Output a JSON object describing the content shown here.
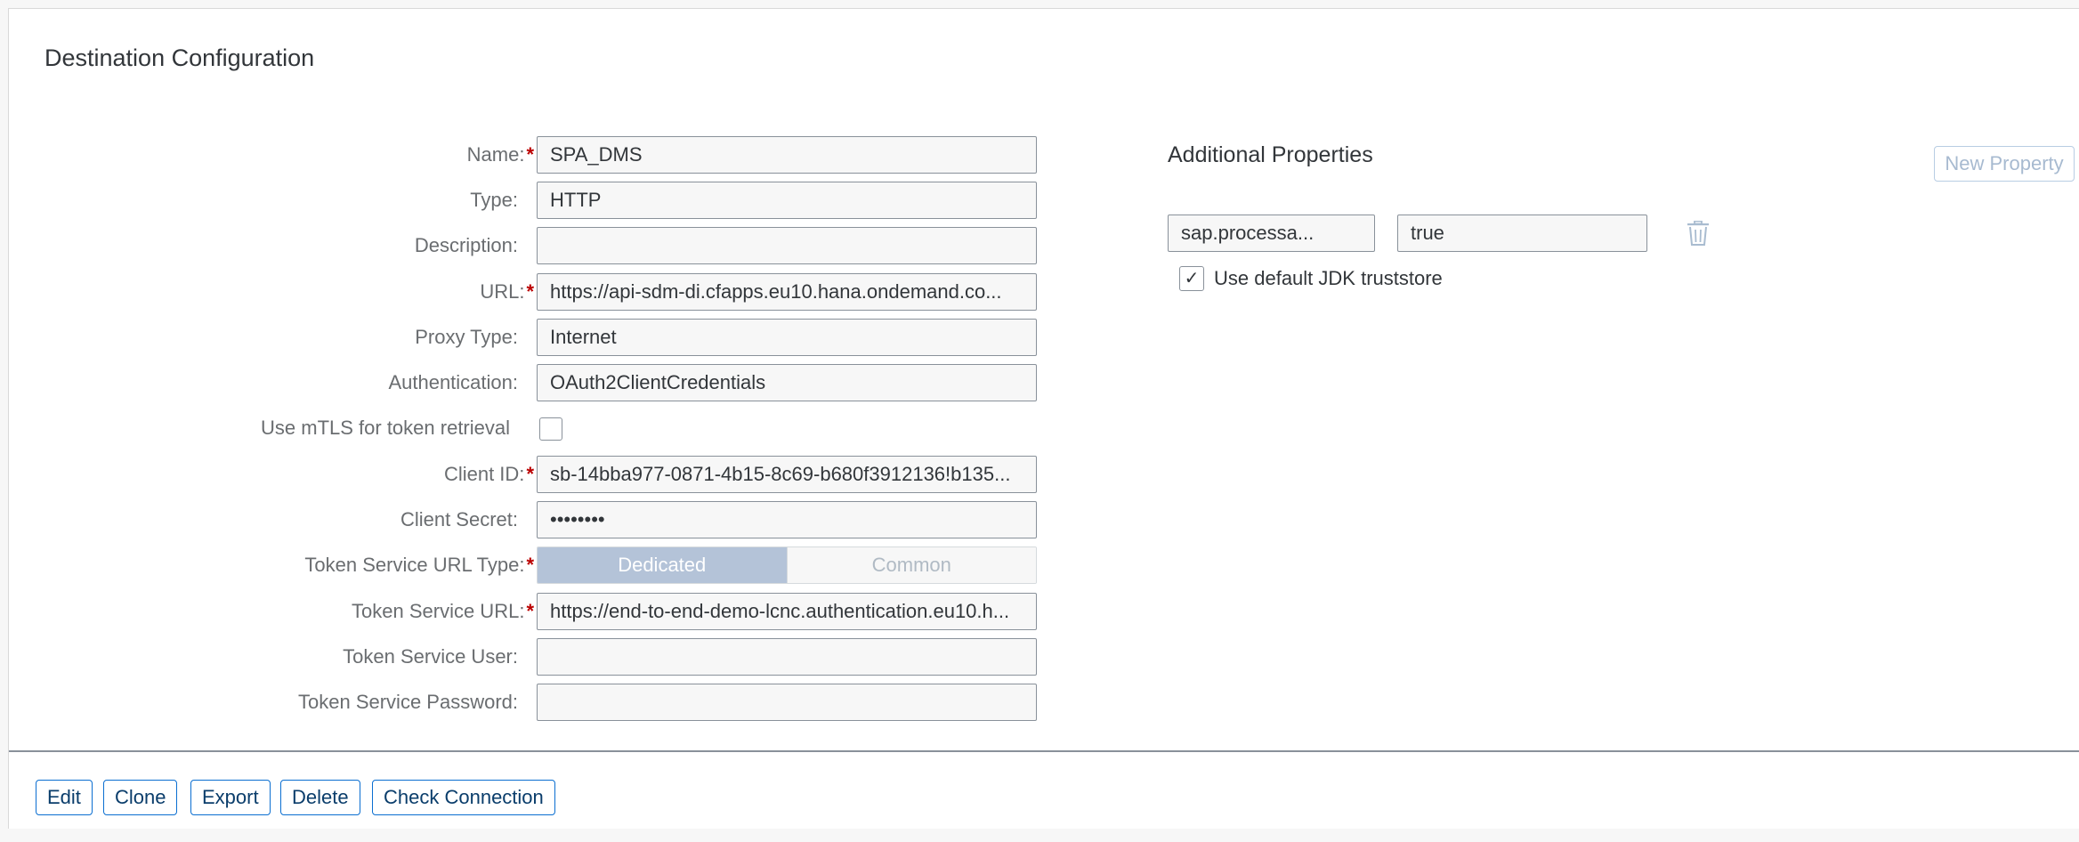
{
  "header": {
    "title": "Destination Configuration"
  },
  "form": {
    "name": {
      "label": "Name:",
      "value": "SPA_DMS"
    },
    "type": {
      "label": "Type:",
      "value": "HTTP"
    },
    "description": {
      "label": "Description:",
      "value": ""
    },
    "url": {
      "label": "URL:",
      "value": "https://api-sdm-di.cfapps.eu10.hana.ondemand.co..."
    },
    "proxy_type": {
      "label": "Proxy Type:",
      "value": "Internet"
    },
    "authentication": {
      "label": "Authentication:",
      "value": "OAuth2ClientCredentials"
    },
    "mtls": {
      "label": "Use mTLS for token retrieval",
      "checked": false
    },
    "client_id": {
      "label": "Client ID:",
      "value": "sb-14bba977-0871-4b15-8c69-b680f3912136!b135..."
    },
    "client_secret": {
      "label": "Client Secret:",
      "value": "••••••••"
    },
    "token_service_url_type": {
      "label": "Token Service URL Type:",
      "options": [
        "Dedicated",
        "Common"
      ],
      "selected": "Dedicated"
    },
    "token_service_url": {
      "label": "Token Service URL:",
      "value": "https://end-to-end-demo-lcnc.authentication.eu10.h..."
    },
    "token_service_user": {
      "label": "Token Service User:",
      "value": ""
    },
    "token_service_password": {
      "label": "Token Service Password:",
      "value": ""
    },
    "required_marker": "*"
  },
  "additional_properties": {
    "title": "Additional Properties",
    "new_property_label": "New Property",
    "properties": [
      {
        "key": "sap.processa...",
        "value": "true"
      }
    ],
    "jdk_truststore": {
      "label": "Use default JDK truststore",
      "checked": true,
      "check_glyph": "✓"
    }
  },
  "footer": {
    "buttons": {
      "edit": "Edit",
      "clone": "Clone",
      "export": "Export",
      "delete": "Delete",
      "check_connection": "Check Connection"
    }
  },
  "colors": {
    "required": "#bb0000",
    "accent": "#0a6ed1",
    "segment_selected": "#b4c3d8"
  }
}
